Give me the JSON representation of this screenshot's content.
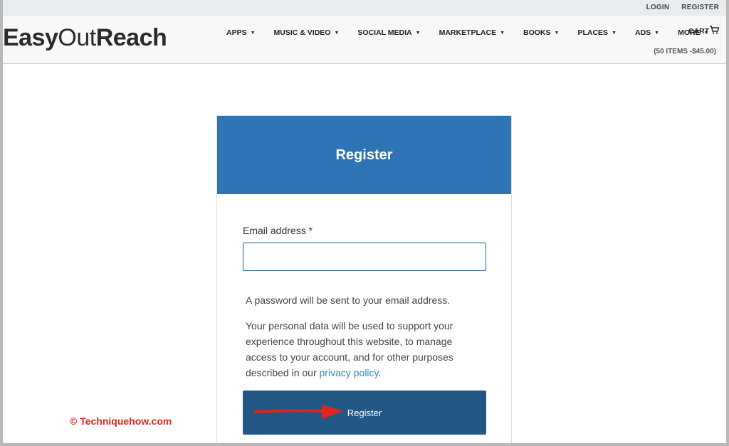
{
  "topbar": {
    "login": "LOGIN",
    "register": "REGISTER"
  },
  "header": {
    "logo_easy": "Easy",
    "logo_out": "Out",
    "logo_reach": "Reach",
    "nav": [
      {
        "label": "APPS"
      },
      {
        "label": "MUSIC & VIDEO"
      },
      {
        "label": "SOCIAL MEDIA"
      },
      {
        "label": "MARKETPLACE"
      },
      {
        "label": "BOOKS"
      },
      {
        "label": "PLACES"
      },
      {
        "label": "ADS"
      },
      {
        "label": "MORE"
      }
    ],
    "cart_label": "CART",
    "cart_summary": "(50 ITEMS -$45.00)"
  },
  "card": {
    "title": "Register",
    "email_label": "Email address *",
    "email_value": "",
    "password_note": "A password will be sent to your email address.",
    "privacy_text": "Your personal data will be used to support your experience throughout this website, to manage access to your account, and for other purposes described in our ",
    "privacy_link": "privacy policy",
    "privacy_end": ".",
    "submit_label": "Register"
  },
  "watermark": "© Techniquehow.com",
  "colors": {
    "primary": "#2f74b5",
    "button": "#235785",
    "link": "#2f86d6",
    "annotation": "#e0261c"
  }
}
